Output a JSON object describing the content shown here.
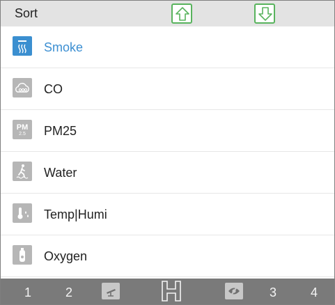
{
  "header": {
    "title": "Sort",
    "move_up_icon": "arrow-up-outline-icon",
    "move_down_icon": "arrow-down-outline-icon",
    "accent_color": "#58b35d"
  },
  "sensors": [
    {
      "label": "Smoke",
      "icon": "smoke-icon",
      "selected": true
    },
    {
      "label": "CO",
      "icon": "co-cloud-icon",
      "selected": false
    },
    {
      "label": "PM25",
      "icon": "pm25-icon",
      "icon_text": "PM",
      "icon_subtext": "2.5",
      "selected": false
    },
    {
      "label": "Water",
      "icon": "water-leak-icon",
      "selected": false
    },
    {
      "label": "Temp|Humi",
      "icon": "temp-humi-icon",
      "selected": false
    },
    {
      "label": "Oxygen",
      "icon": "oxygen-icon",
      "selected": false
    }
  ],
  "colors": {
    "selected_text": "#3c8fd2",
    "selected_icon": "#3b8fd0",
    "icon_bg": "#b6b6b6",
    "footer_bg": "#7a7a7a"
  },
  "footer": {
    "tab1": "1",
    "tab2": "2",
    "tab3": "3",
    "tab4": "4",
    "icons": [
      "camera-icon",
      "h-icon",
      "visibility-icon"
    ]
  }
}
